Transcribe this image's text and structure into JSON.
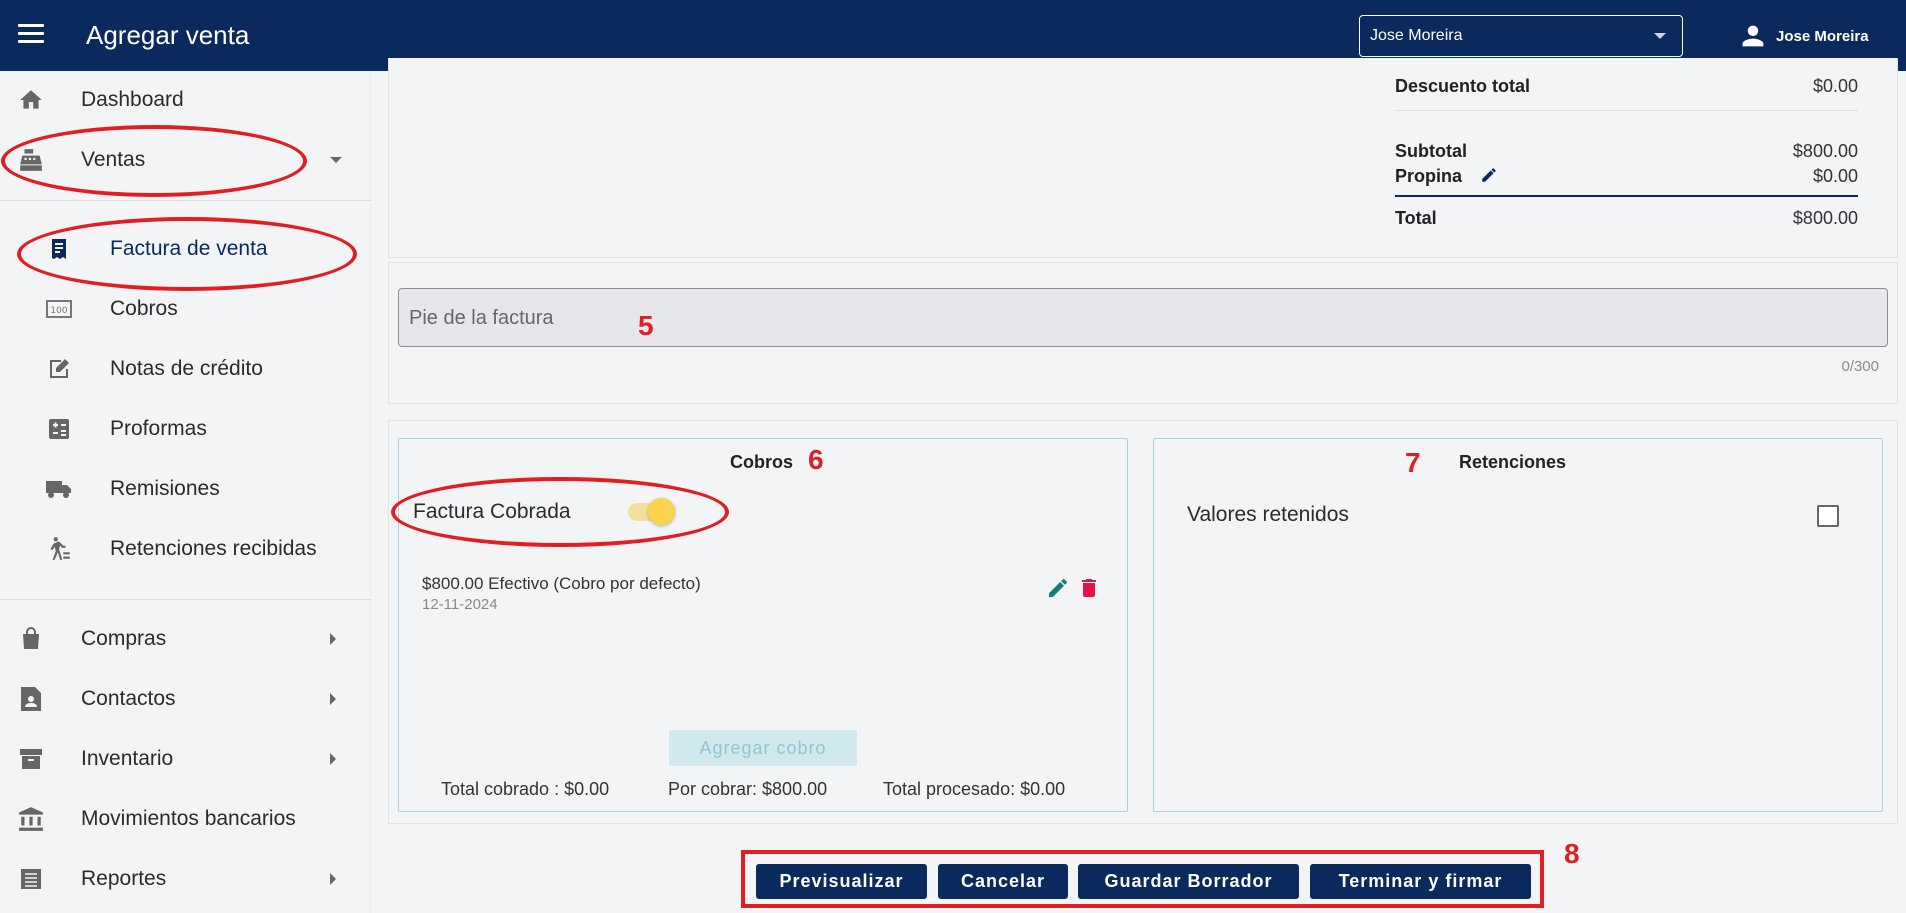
{
  "topbar": {
    "title": "Agregar venta",
    "user_select_value": "Jose Moreira",
    "account_name": "Jose Moreira",
    "bg_color": "#0a2a5e"
  },
  "sidebar": {
    "items": [
      {
        "label": "Dashboard",
        "icon": "home-icon"
      },
      {
        "label": "Ventas",
        "icon": "cash-register-icon"
      },
      {
        "label": "Factura de venta",
        "icon": "invoice-icon"
      },
      {
        "label": "Cobros",
        "icon": "cash-icon"
      },
      {
        "label": "Notas de crédito",
        "icon": "note-edit-icon"
      },
      {
        "label": "Proformas",
        "icon": "calculator-icon"
      },
      {
        "label": "Remisiones",
        "icon": "truck-icon"
      },
      {
        "label": "Retenciones recibidas",
        "icon": "walk-icon"
      },
      {
        "label": "Compras",
        "icon": "shopping-bag-icon"
      },
      {
        "label": "Contactos",
        "icon": "contact-icon"
      },
      {
        "label": "Inventario",
        "icon": "archive-icon"
      },
      {
        "label": "Movimientos bancarios",
        "icon": "bank-icon"
      },
      {
        "label": "Reportes",
        "icon": "report-icon"
      }
    ]
  },
  "totals": {
    "descuento_label": "Descuento total",
    "descuento_value": "$0.00",
    "subtotal_label": "Subtotal",
    "subtotal_value": "$800.00",
    "propina_label": "Propina",
    "propina_value": "$0.00",
    "total_label": "Total",
    "total_value": "$800.00"
  },
  "footer": {
    "placeholder": "Pie de la factura",
    "counter": "0/300"
  },
  "cobros": {
    "title": "Cobros",
    "toggle_label": "Factura Cobrada",
    "toggle_on": true,
    "item_line": "$800.00 Efectivo (Cobro por defecto)",
    "item_date": "12-11-2024",
    "add_button": "Agregar cobro",
    "total_cobrado": "Total cobrado : $0.00",
    "por_cobrar": "Por cobrar: $800.00",
    "total_procesado": "Total procesado: $0.00"
  },
  "retenciones": {
    "title": "Retenciones",
    "valores_label": "Valores retenidos",
    "checked": false
  },
  "actions": {
    "preview": "Previsualizar",
    "cancel": "Cancelar",
    "save_draft": "Guardar Borrador",
    "finish_sign": "Terminar y firmar"
  },
  "annotations": {
    "n5": "5",
    "n6": "6",
    "n7": "7",
    "n8": "8",
    "color": "#e01e24"
  }
}
